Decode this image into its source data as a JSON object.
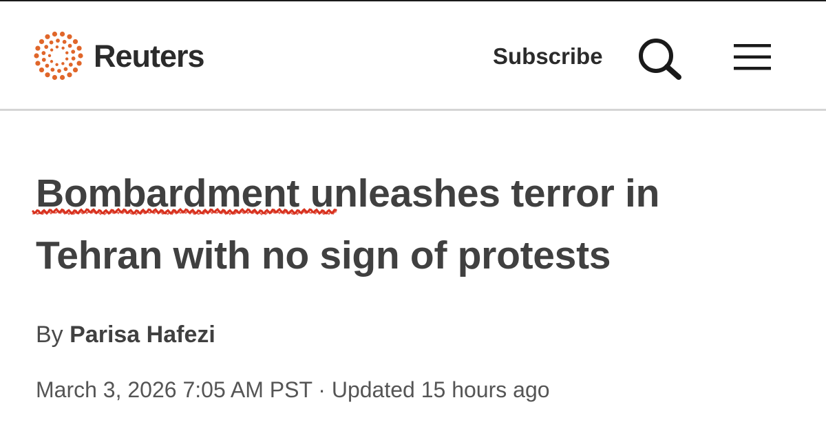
{
  "header": {
    "brand": "Reuters",
    "logo_icon": "reuters-dot-ring-icon",
    "subscribe_label": "Subscribe",
    "search_icon": "search-icon",
    "menu_icon": "hamburger-menu-icon"
  },
  "article": {
    "headline_marked": "Bombardment",
    "headline_rest": " unleashes terror in Tehran with no sign of protests",
    "byline_prefix": "By ",
    "author": "Parisa Hafezi",
    "published": "March 3, 2026 7:05 AM PST",
    "separator": " · ",
    "updated": "Updated 15 hours ago"
  },
  "annotation": {
    "type": "red-squiggle-underline",
    "target": "Bombardment",
    "color": "#d8321f"
  },
  "colors": {
    "logo_accent": "#e0662a",
    "text_dark": "#2b2b2b",
    "text_body": "#404040",
    "divider": "#d4d4d4"
  }
}
